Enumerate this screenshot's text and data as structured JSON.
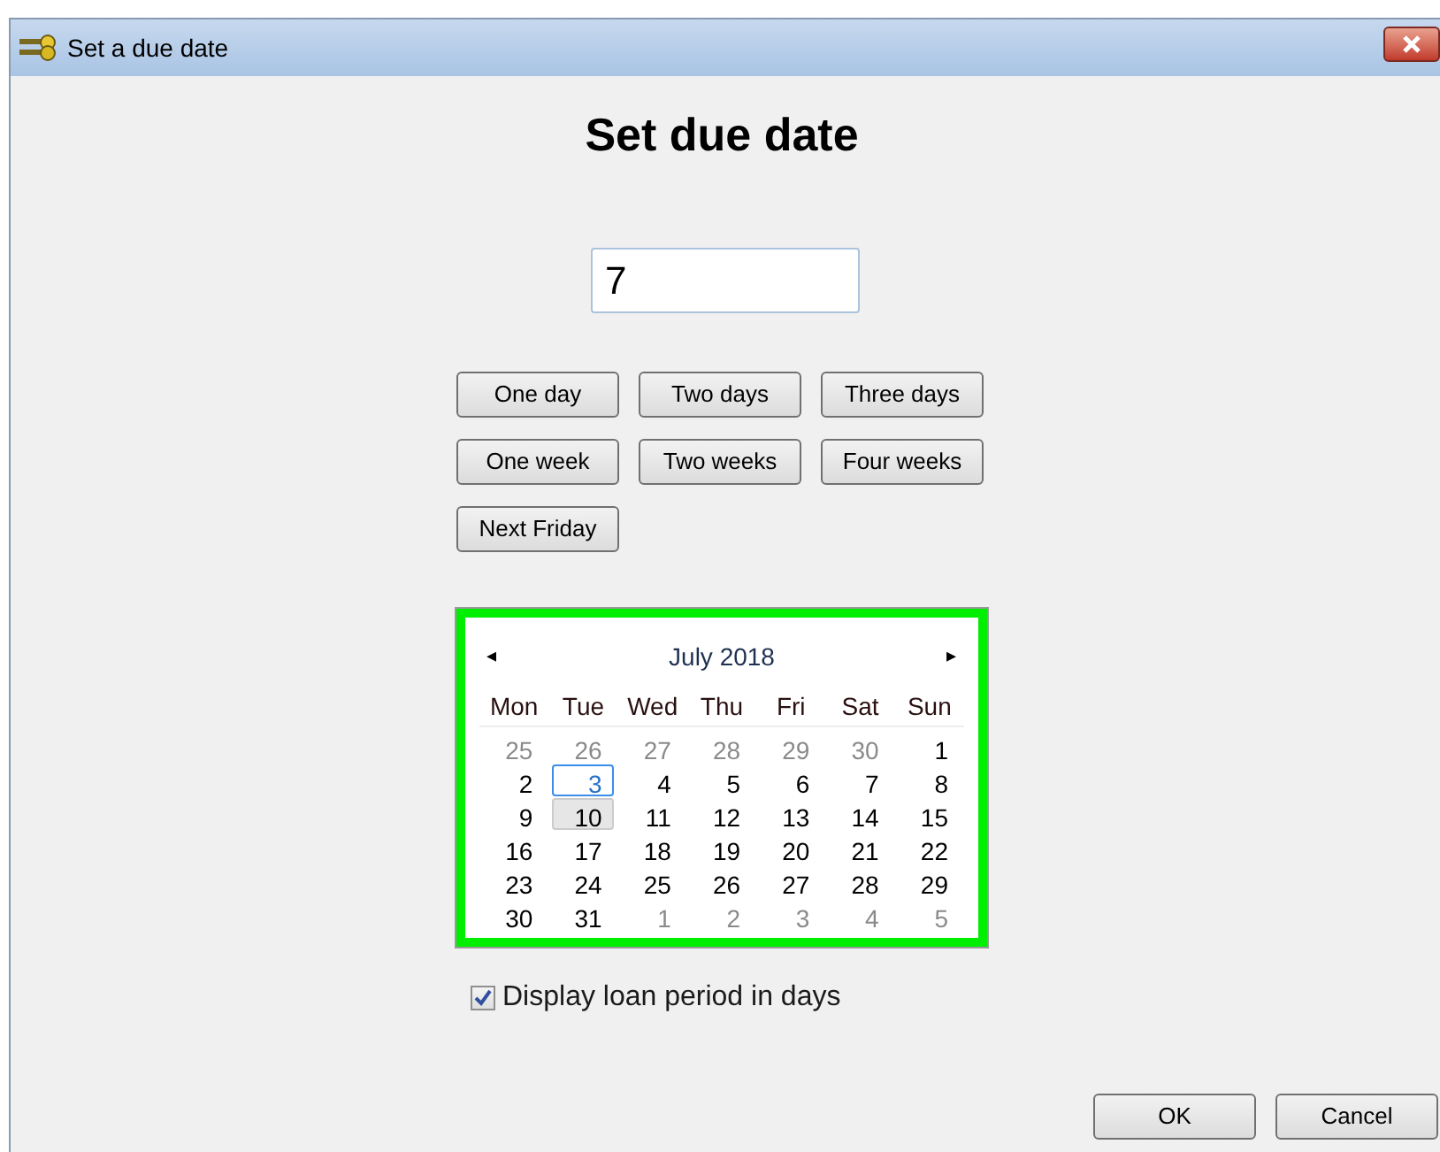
{
  "window": {
    "title": "Set a due date"
  },
  "heading": "Set due date",
  "days_field": {
    "value": "7"
  },
  "quick_buttons": [
    "One day",
    "Two days",
    "Three days",
    "One week",
    "Two weeks",
    "Four weeks",
    "Next Friday"
  ],
  "calendar": {
    "month": "July 2018",
    "prev": "◂",
    "next": "▸",
    "weekdays": [
      "Mon",
      "Tue",
      "Wed",
      "Thu",
      "Fri",
      "Sat",
      "Sun"
    ],
    "days": [
      {
        "label": "25",
        "outside": true,
        "today": false,
        "selected": false
      },
      {
        "label": "26",
        "outside": true,
        "today": false,
        "selected": false
      },
      {
        "label": "27",
        "outside": true,
        "today": false,
        "selected": false
      },
      {
        "label": "28",
        "outside": true,
        "today": false,
        "selected": false
      },
      {
        "label": "29",
        "outside": true,
        "today": false,
        "selected": false
      },
      {
        "label": "30",
        "outside": true,
        "today": false,
        "selected": false
      },
      {
        "label": "1",
        "outside": false,
        "today": false,
        "selected": false
      },
      {
        "label": "2",
        "outside": false,
        "today": false,
        "selected": false
      },
      {
        "label": "3",
        "outside": false,
        "today": true,
        "selected": false
      },
      {
        "label": "4",
        "outside": false,
        "today": false,
        "selected": false
      },
      {
        "label": "5",
        "outside": false,
        "today": false,
        "selected": false
      },
      {
        "label": "6",
        "outside": false,
        "today": false,
        "selected": false
      },
      {
        "label": "7",
        "outside": false,
        "today": false,
        "selected": false
      },
      {
        "label": "8",
        "outside": false,
        "today": false,
        "selected": false
      },
      {
        "label": "9",
        "outside": false,
        "today": false,
        "selected": false
      },
      {
        "label": "10",
        "outside": false,
        "today": false,
        "selected": true
      },
      {
        "label": "11",
        "outside": false,
        "today": false,
        "selected": false
      },
      {
        "label": "12",
        "outside": false,
        "today": false,
        "selected": false
      },
      {
        "label": "13",
        "outside": false,
        "today": false,
        "selected": false
      },
      {
        "label": "14",
        "outside": false,
        "today": false,
        "selected": false
      },
      {
        "label": "15",
        "outside": false,
        "today": false,
        "selected": false
      },
      {
        "label": "16",
        "outside": false,
        "today": false,
        "selected": false
      },
      {
        "label": "17",
        "outside": false,
        "today": false,
        "selected": false
      },
      {
        "label": "18",
        "outside": false,
        "today": false,
        "selected": false
      },
      {
        "label": "19",
        "outside": false,
        "today": false,
        "selected": false
      },
      {
        "label": "20",
        "outside": false,
        "today": false,
        "selected": false
      },
      {
        "label": "21",
        "outside": false,
        "today": false,
        "selected": false
      },
      {
        "label": "22",
        "outside": false,
        "today": false,
        "selected": false
      },
      {
        "label": "23",
        "outside": false,
        "today": false,
        "selected": false
      },
      {
        "label": "24",
        "outside": false,
        "today": false,
        "selected": false
      },
      {
        "label": "25",
        "outside": false,
        "today": false,
        "selected": false
      },
      {
        "label": "26",
        "outside": false,
        "today": false,
        "selected": false
      },
      {
        "label": "27",
        "outside": false,
        "today": false,
        "selected": false
      },
      {
        "label": "28",
        "outside": false,
        "today": false,
        "selected": false
      },
      {
        "label": "29",
        "outside": false,
        "today": false,
        "selected": false
      },
      {
        "label": "30",
        "outside": false,
        "today": false,
        "selected": false
      },
      {
        "label": "31",
        "outside": false,
        "today": false,
        "selected": false
      },
      {
        "label": "1",
        "outside": true,
        "today": false,
        "selected": false
      },
      {
        "label": "2",
        "outside": true,
        "today": false,
        "selected": false
      },
      {
        "label": "3",
        "outside": true,
        "today": false,
        "selected": false
      },
      {
        "label": "4",
        "outside": true,
        "today": false,
        "selected": false
      },
      {
        "label": "5",
        "outside": true,
        "today": false,
        "selected": false
      }
    ]
  },
  "display_days": {
    "label": "Display loan period in days",
    "checked": true
  },
  "buttons": [
    "OK",
    "Cancel"
  ]
}
